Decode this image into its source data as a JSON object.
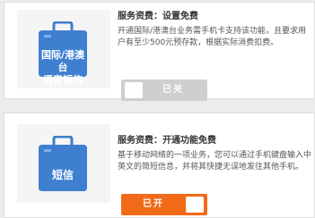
{
  "colors": {
    "accent": "#f06a18",
    "icon_bg": "#3f7fd0",
    "toggle_off": "#cfcfcf"
  },
  "services": [
    {
      "icon_name": "bag-icon",
      "icon_text_line1": "国际/港澳台",
      "icon_text_line2": "语音短信",
      "fee_label": "服务资费：设置免费",
      "description": "开通国际/港澳台业务需手机卡支持该功能，且要求用户有至少500元预存款，根据实际消费扣费。",
      "toggle": {
        "state": "off",
        "label": "已关"
      }
    },
    {
      "icon_name": "bag-icon",
      "icon_text_line1": "短信",
      "fee_label": "服务资费：开通功能免费",
      "description": "基于移动网络的一项业务，您可以通过手机键盘输入中英文的简短信息，并将其快捷无误地发往其他手机。",
      "toggle": {
        "state": "on",
        "label": "已开"
      }
    }
  ]
}
